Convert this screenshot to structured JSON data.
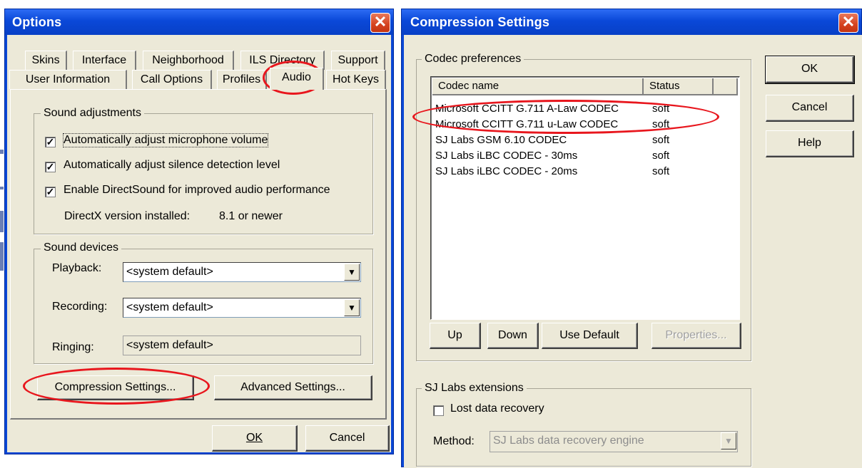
{
  "options": {
    "title": "Options",
    "tabs_row1": [
      "Skins",
      "Interface",
      "Neighborhood",
      "ILS Directory",
      "Support"
    ],
    "tabs_row2": [
      "User Information",
      "Call Options",
      "Profiles",
      "Audio",
      "Hot Keys"
    ],
    "active_tab": "Audio",
    "sound_adjustments": {
      "label": "Sound adjustments",
      "auto_mic": {
        "label": "Automatically adjust microphone volume",
        "checked": true
      },
      "auto_silence": {
        "label": "Automatically adjust silence detection level",
        "checked": true
      },
      "directsound": {
        "label": "Enable DirectSound for improved audio performance",
        "checked": true
      },
      "directx_label": "DirectX version installed:",
      "directx_value": "8.1 or newer"
    },
    "sound_devices": {
      "label": "Sound devices",
      "playback_label": "Playback:",
      "playback_value": "<system default>",
      "recording_label": "Recording:",
      "recording_value": "<system default>",
      "ringing_label": "Ringing:",
      "ringing_value": "<system default>"
    },
    "compression_button": "Compression Settings...",
    "advanced_button": "Advanced Settings...",
    "ok_button": "OK",
    "cancel_button": "Cancel"
  },
  "compression": {
    "title": "Compression Settings",
    "codec_group_label": "Codec preferences",
    "columns": [
      "Codec name",
      "Status"
    ],
    "codecs": [
      {
        "name": "Microsoft CCITT G.711 A-Law CODEC",
        "status": "soft"
      },
      {
        "name": "Microsoft CCITT G.711 u-Law CODEC",
        "status": "soft"
      },
      {
        "name": "SJ Labs GSM 6.10 CODEC",
        "status": "soft"
      },
      {
        "name": "SJ Labs iLBC CODEC - 30ms",
        "status": "soft"
      },
      {
        "name": "SJ Labs iLBC CODEC - 20ms",
        "status": "soft"
      }
    ],
    "up_button": "Up",
    "down_button": "Down",
    "use_default_button": "Use Default",
    "properties_button": "Properties...",
    "ok_button": "OK",
    "cancel_button": "Cancel",
    "help_button": "Help",
    "extensions_label": "SJ Labs extensions",
    "lost_data_recovery": {
      "label": "Lost data recovery",
      "checked": false
    },
    "method_label": "Method:",
    "method_value": "SJ Labs data recovery engine"
  },
  "colors": {
    "titlebar": "#0a48d8",
    "dialog_face": "#ece9d8",
    "annotation_red": "#e8161d",
    "close_button": "#d5421f"
  },
  "icons": [
    "close-icon",
    "dropdown-arrow-icon",
    "checkmark-icon"
  ]
}
